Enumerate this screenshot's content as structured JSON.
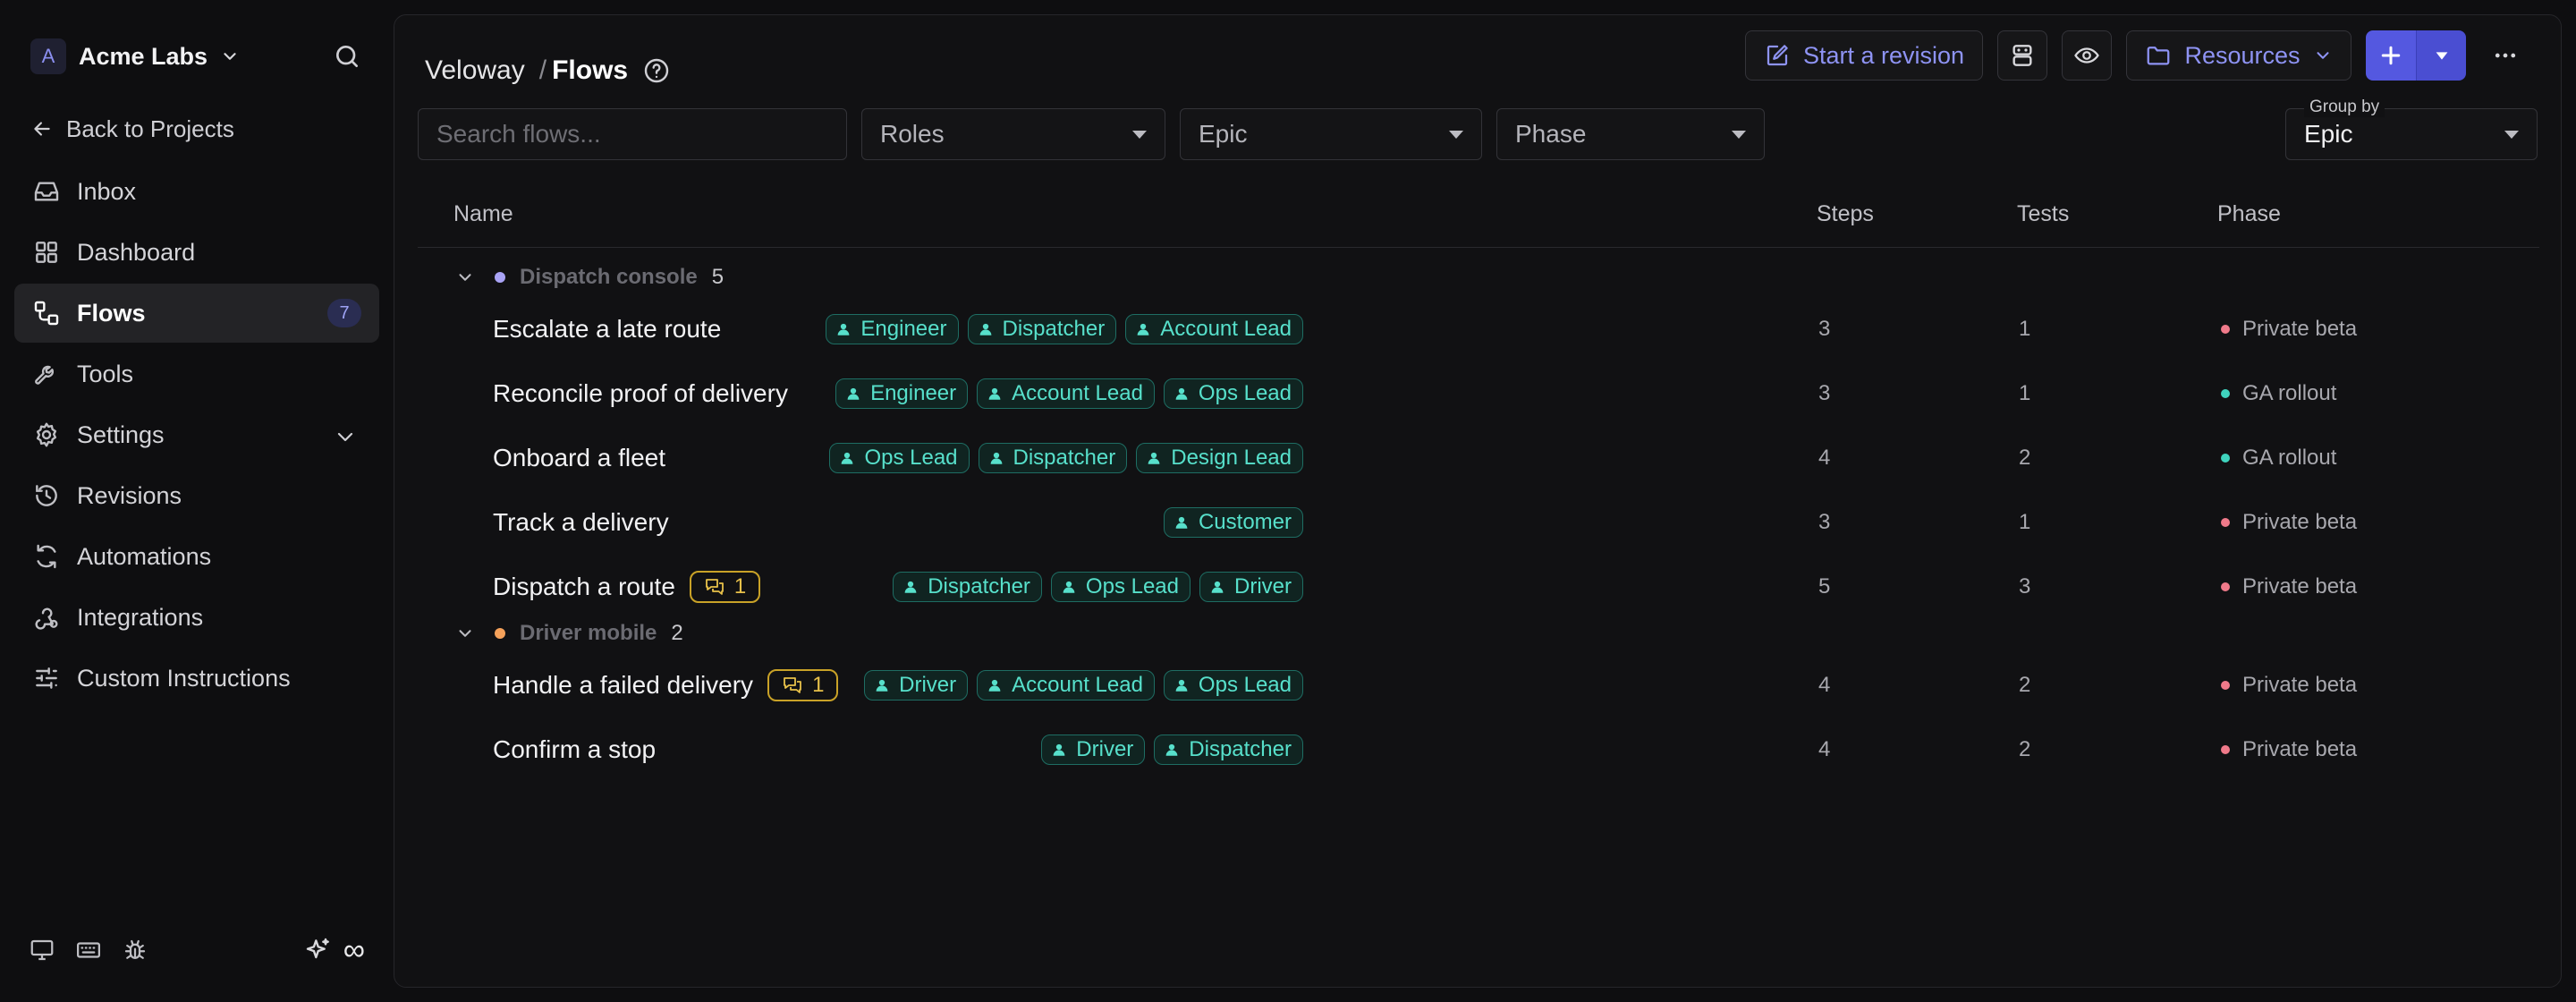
{
  "workspace": {
    "initial": "A",
    "name": "Acme Labs"
  },
  "sidebar": {
    "back_label": "Back to Projects",
    "items": [
      {
        "label": "Inbox",
        "icon": "inbox-icon"
      },
      {
        "label": "Dashboard",
        "icon": "grid-icon"
      },
      {
        "label": "Flows",
        "icon": "flow-icon",
        "badge": "7",
        "active": true
      },
      {
        "label": "Tools",
        "icon": "wrench-icon"
      },
      {
        "label": "Settings",
        "icon": "gear-icon",
        "expandable": true
      },
      {
        "label": "Revisions",
        "icon": "history-icon"
      },
      {
        "label": "Automations",
        "icon": "refresh-icon"
      },
      {
        "label": "Integrations",
        "icon": "webhook-icon"
      },
      {
        "label": "Custom Instructions",
        "icon": "sliders-icon"
      }
    ],
    "footer_infinity": "∞"
  },
  "breadcrumb": {
    "project": "Veloway",
    "separator": "/",
    "page": "Flows"
  },
  "toolbar": {
    "revision_label": "Start a revision",
    "resources_label": "Resources"
  },
  "filters": {
    "search_placeholder": "Search flows...",
    "roles_label": "Roles",
    "epic_label": "Epic",
    "phase_label": "Phase"
  },
  "group_by": {
    "label": "Group by",
    "value": "Epic"
  },
  "table": {
    "headers": {
      "name": "Name",
      "steps": "Steps",
      "tests": "Tests",
      "phase": "Phase"
    },
    "groups": [
      {
        "name": "Dispatch console",
        "count": "5",
        "dot_color": "#a9a3f5",
        "rows": [
          {
            "name": "Escalate a late route",
            "roles": [
              "Engineer",
              "Dispatcher",
              "Account Lead"
            ],
            "steps": "3",
            "tests": "1",
            "phase": "Private beta",
            "comments": null
          },
          {
            "name": "Reconcile proof of delivery",
            "roles": [
              "Engineer",
              "Account Lead",
              "Ops Lead"
            ],
            "steps": "3",
            "tests": "1",
            "phase": "GA rollout",
            "comments": null
          },
          {
            "name": "Onboard a fleet",
            "roles": [
              "Ops Lead",
              "Dispatcher",
              "Design Lead"
            ],
            "steps": "4",
            "tests": "2",
            "phase": "GA rollout",
            "comments": null
          },
          {
            "name": "Track a delivery",
            "roles": [
              "Customer"
            ],
            "steps": "3",
            "tests": "1",
            "phase": "Private beta",
            "comments": null
          },
          {
            "name": "Dispatch a route",
            "roles": [
              "Dispatcher",
              "Ops Lead",
              "Driver"
            ],
            "steps": "5",
            "tests": "3",
            "phase": "Private beta",
            "comments": "1"
          }
        ]
      },
      {
        "name": "Driver mobile",
        "count": "2",
        "dot_color": "#f5a15a",
        "rows": [
          {
            "name": "Handle a failed delivery",
            "roles": [
              "Driver",
              "Account Lead",
              "Ops Lead"
            ],
            "steps": "4",
            "tests": "2",
            "phase": "Private beta",
            "comments": "1"
          },
          {
            "name": "Confirm a stop",
            "roles": [
              "Driver",
              "Dispatcher"
            ],
            "steps": "4",
            "tests": "2",
            "phase": "Private beta",
            "comments": null
          }
        ]
      }
    ]
  },
  "colors": {
    "accent": "#5458e0",
    "accent_text": "#8e93f3",
    "chip_text": "#57e0cb",
    "phase_private_beta": "#f07a8a",
    "phase_ga_rollout": "#3fd4be",
    "comment": "#e8c14a"
  }
}
